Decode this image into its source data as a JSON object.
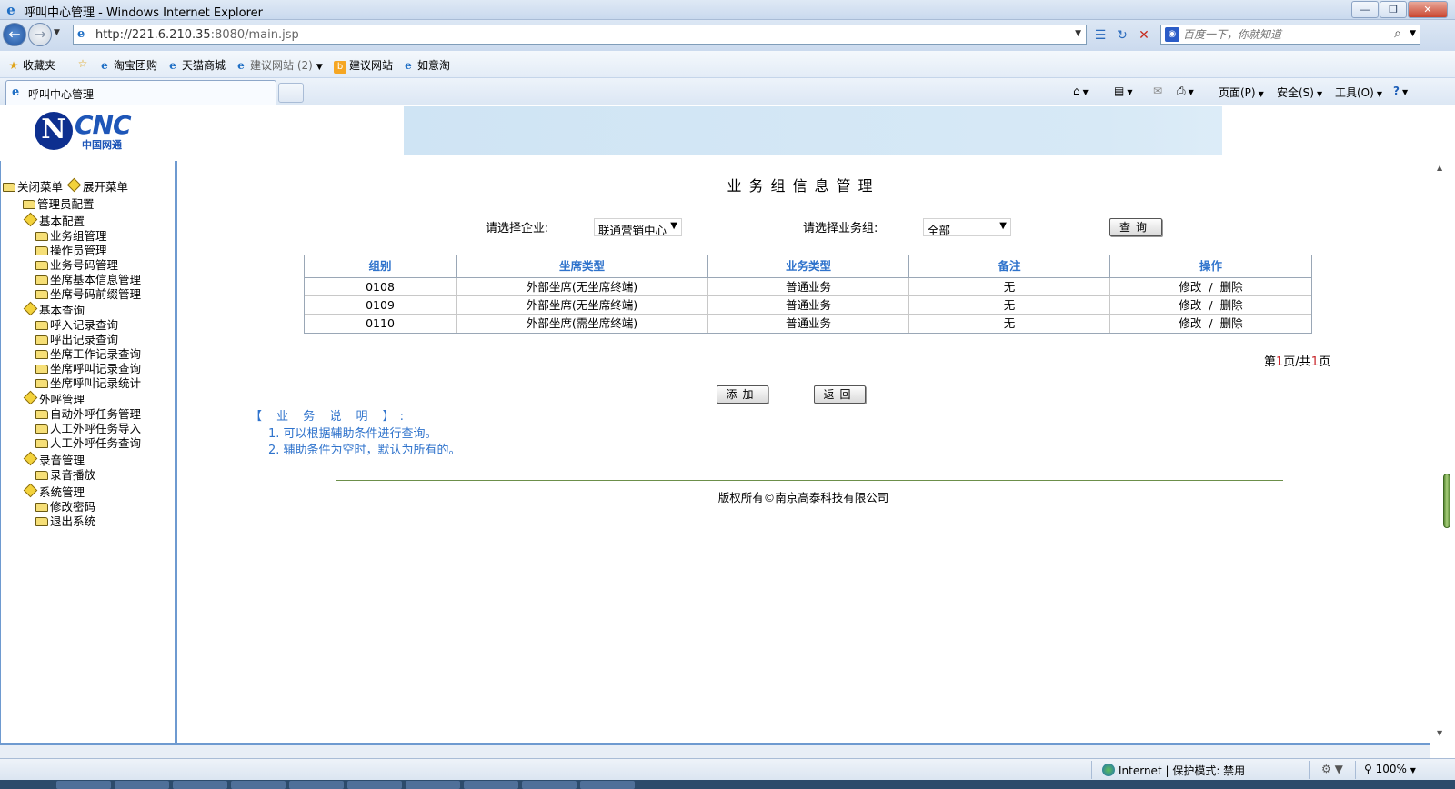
{
  "window": {
    "title": "呼叫中心管理 - Windows Internet Explorer",
    "buttons": {
      "minimize": "—",
      "maximize": "❐",
      "close": "✕"
    }
  },
  "address_bar": {
    "url_host": "http://221.6.210.35",
    "url_rest": ":8080/main.jsp",
    "search_placeholder": "百度一下，你就知道"
  },
  "favorites_bar": {
    "favorites_label": "收藏夹",
    "items": [
      {
        "label": "淘宝团购",
        "icon": "ie-page-icon"
      },
      {
        "label": "天猫商城",
        "icon": "ie-page-icon"
      },
      {
        "label": "建议网站 (2)",
        "icon": "ie-page-icon"
      },
      {
        "label": "建议网站",
        "icon": "bing-icon"
      },
      {
        "label": "如意淘",
        "icon": "ie-page-icon"
      }
    ]
  },
  "tabs": {
    "active_tab": "呼叫中心管理"
  },
  "command_bar": {
    "page": "页面(P)",
    "safety": "安全(S)",
    "tools": "工具(O)"
  },
  "sidebar": {
    "collapse_all": "关闭菜单",
    "expand_all": "展开菜单",
    "items": [
      {
        "label": "管理员配置",
        "level": 1,
        "icon": "folder-icon"
      },
      {
        "label": "基本配置",
        "level": 1,
        "icon": "diamond-icon"
      },
      {
        "label": "业务组管理",
        "level": 2,
        "icon": "folder-icon"
      },
      {
        "label": "操作员管理",
        "level": 2,
        "icon": "folder-icon"
      },
      {
        "label": "业务号码管理",
        "level": 2,
        "icon": "folder-icon"
      },
      {
        "label": "坐席基本信息管理",
        "level": 2,
        "icon": "folder-icon"
      },
      {
        "label": "坐席号码前缀管理",
        "level": 2,
        "icon": "folder-icon"
      },
      {
        "label": "基本查询",
        "level": 1,
        "icon": "diamond-icon"
      },
      {
        "label": "呼入记录查询",
        "level": 2,
        "icon": "folder-icon"
      },
      {
        "label": "呼出记录查询",
        "level": 2,
        "icon": "folder-icon"
      },
      {
        "label": "坐席工作记录查询",
        "level": 2,
        "icon": "folder-icon"
      },
      {
        "label": "坐席呼叫记录查询",
        "level": 2,
        "icon": "folder-icon"
      },
      {
        "label": "坐席呼叫记录统计",
        "level": 2,
        "icon": "folder-icon"
      },
      {
        "label": "外呼管理",
        "level": 1,
        "icon": "diamond-icon"
      },
      {
        "label": "自动外呼任务管理",
        "level": 2,
        "icon": "folder-icon"
      },
      {
        "label": "人工外呼任务导入",
        "level": 2,
        "icon": "folder-icon"
      },
      {
        "label": "人工外呼任务查询",
        "level": 2,
        "icon": "folder-icon"
      },
      {
        "label": "录音管理",
        "level": 1,
        "icon": "diamond-icon"
      },
      {
        "label": "录音播放",
        "level": 2,
        "icon": "folder-icon"
      },
      {
        "label": "系统管理",
        "level": 1,
        "icon": "diamond-icon"
      },
      {
        "label": "修改密码",
        "level": 2,
        "icon": "folder-icon"
      },
      {
        "label": "退出系统",
        "level": 2,
        "icon": "folder-icon"
      }
    ]
  },
  "logo": {
    "mark": "N",
    "brand": "CNC",
    "brand_cn": "中国网通"
  },
  "main": {
    "heading": "业务组信息管理",
    "filters": {
      "enterprise_label": "请选择企业:",
      "enterprise_value": "联通营销中心",
      "group_label": "请选择业务组:",
      "group_value": "全部",
      "query_button": "查询"
    },
    "table": {
      "headers": [
        "组别",
        "坐席类型",
        "业务类型",
        "备注",
        "操作"
      ],
      "rows": [
        {
          "group": "0108",
          "seat_type": "外部坐席(无坐席终端)",
          "biz_type": "普通业务",
          "note": "无",
          "edit": "修改",
          "sep": "/",
          "del": "删除"
        },
        {
          "group": "0109",
          "seat_type": "外部坐席(无坐席终端)",
          "biz_type": "普通业务",
          "note": "无",
          "edit": "修改",
          "sep": "/",
          "del": "删除"
        },
        {
          "group": "0110",
          "seat_type": "外部坐席(需坐席终端)",
          "biz_type": "普通业务",
          "note": "无",
          "edit": "修改",
          "sep": "/",
          "del": "删除"
        }
      ]
    },
    "pager": {
      "prefix": "第",
      "current": "1",
      "mid": "页/共",
      "total": "1",
      "suffix": "页"
    },
    "add_button": "添加",
    "back_button": "返回",
    "notes": {
      "title": "【 业 务 说 明 】:",
      "items": [
        "1.  可以根据辅助条件进行查询。",
        "2.  辅助条件为空时，默认为所有的。"
      ]
    },
    "copyright": "版权所有©南京高泰科技有限公司"
  },
  "status_bar": {
    "zone": "Internet | 保护模式: 禁用",
    "zoom": "100%"
  },
  "colors": {
    "link_blue": "#2f73cc",
    "frame_border": "#6e9ad0",
    "pager_red": "#c8262b"
  }
}
